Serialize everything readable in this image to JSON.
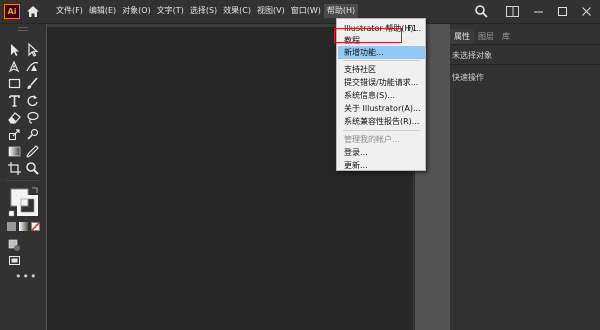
{
  "app": {
    "logo_text": "Ai",
    "brand_color": "#ff9a00"
  },
  "menubar": {
    "items": [
      {
        "label": "文件(F)"
      },
      {
        "label": "编辑(E)"
      },
      {
        "label": "对象(O)"
      },
      {
        "label": "文字(T)"
      },
      {
        "label": "选择(S)"
      },
      {
        "label": "效果(C)"
      },
      {
        "label": "视图(V)"
      },
      {
        "label": "窗口(W)"
      },
      {
        "label": "帮助(H)",
        "active": true
      }
    ]
  },
  "help_menu": {
    "items": [
      {
        "label": "Illustrator 帮助(H)...",
        "shortcut": "F1"
      },
      {
        "label": "教程...",
        "highlighted_box": true
      },
      {
        "label": "新增功能...",
        "hover": true
      },
      {
        "label": "支持社区"
      },
      {
        "label": "提交错误/功能请求..."
      },
      {
        "label": "系统信息(S)..."
      },
      {
        "label": "关于 Illustrator(A)..."
      },
      {
        "label": "系统兼容性报告(R)..."
      },
      {
        "label": "管理我的帐户...",
        "disabled": true
      },
      {
        "label": "登录..."
      },
      {
        "label": "更新..."
      }
    ],
    "highlight_color": "#91c9f7",
    "callout_color": "#e8151d"
  },
  "right_panel": {
    "tabs": [
      {
        "label": "属性",
        "active": true
      },
      {
        "label": "图层"
      },
      {
        "label": "库"
      }
    ],
    "no_selection_text": "未选择对象",
    "quick_actions_text": "快速操作"
  },
  "icons": {
    "top": [
      "home-icon",
      "search-icon",
      "panels-icon",
      "minimize-icon",
      "maximize-icon",
      "close-icon"
    ],
    "tools": [
      "selection-tool",
      "direct-selection-tool",
      "pen-tool",
      "curvature-tool",
      "rectangle-tool",
      "paintbrush-tool",
      "type-tool",
      "rotate-tool",
      "eraser-tool",
      "rotate-view-tool",
      "scale-tool",
      "warp-tool",
      "gradient-tool",
      "eyedropper-tool",
      "artboard-tool",
      "zoom-tool"
    ]
  }
}
